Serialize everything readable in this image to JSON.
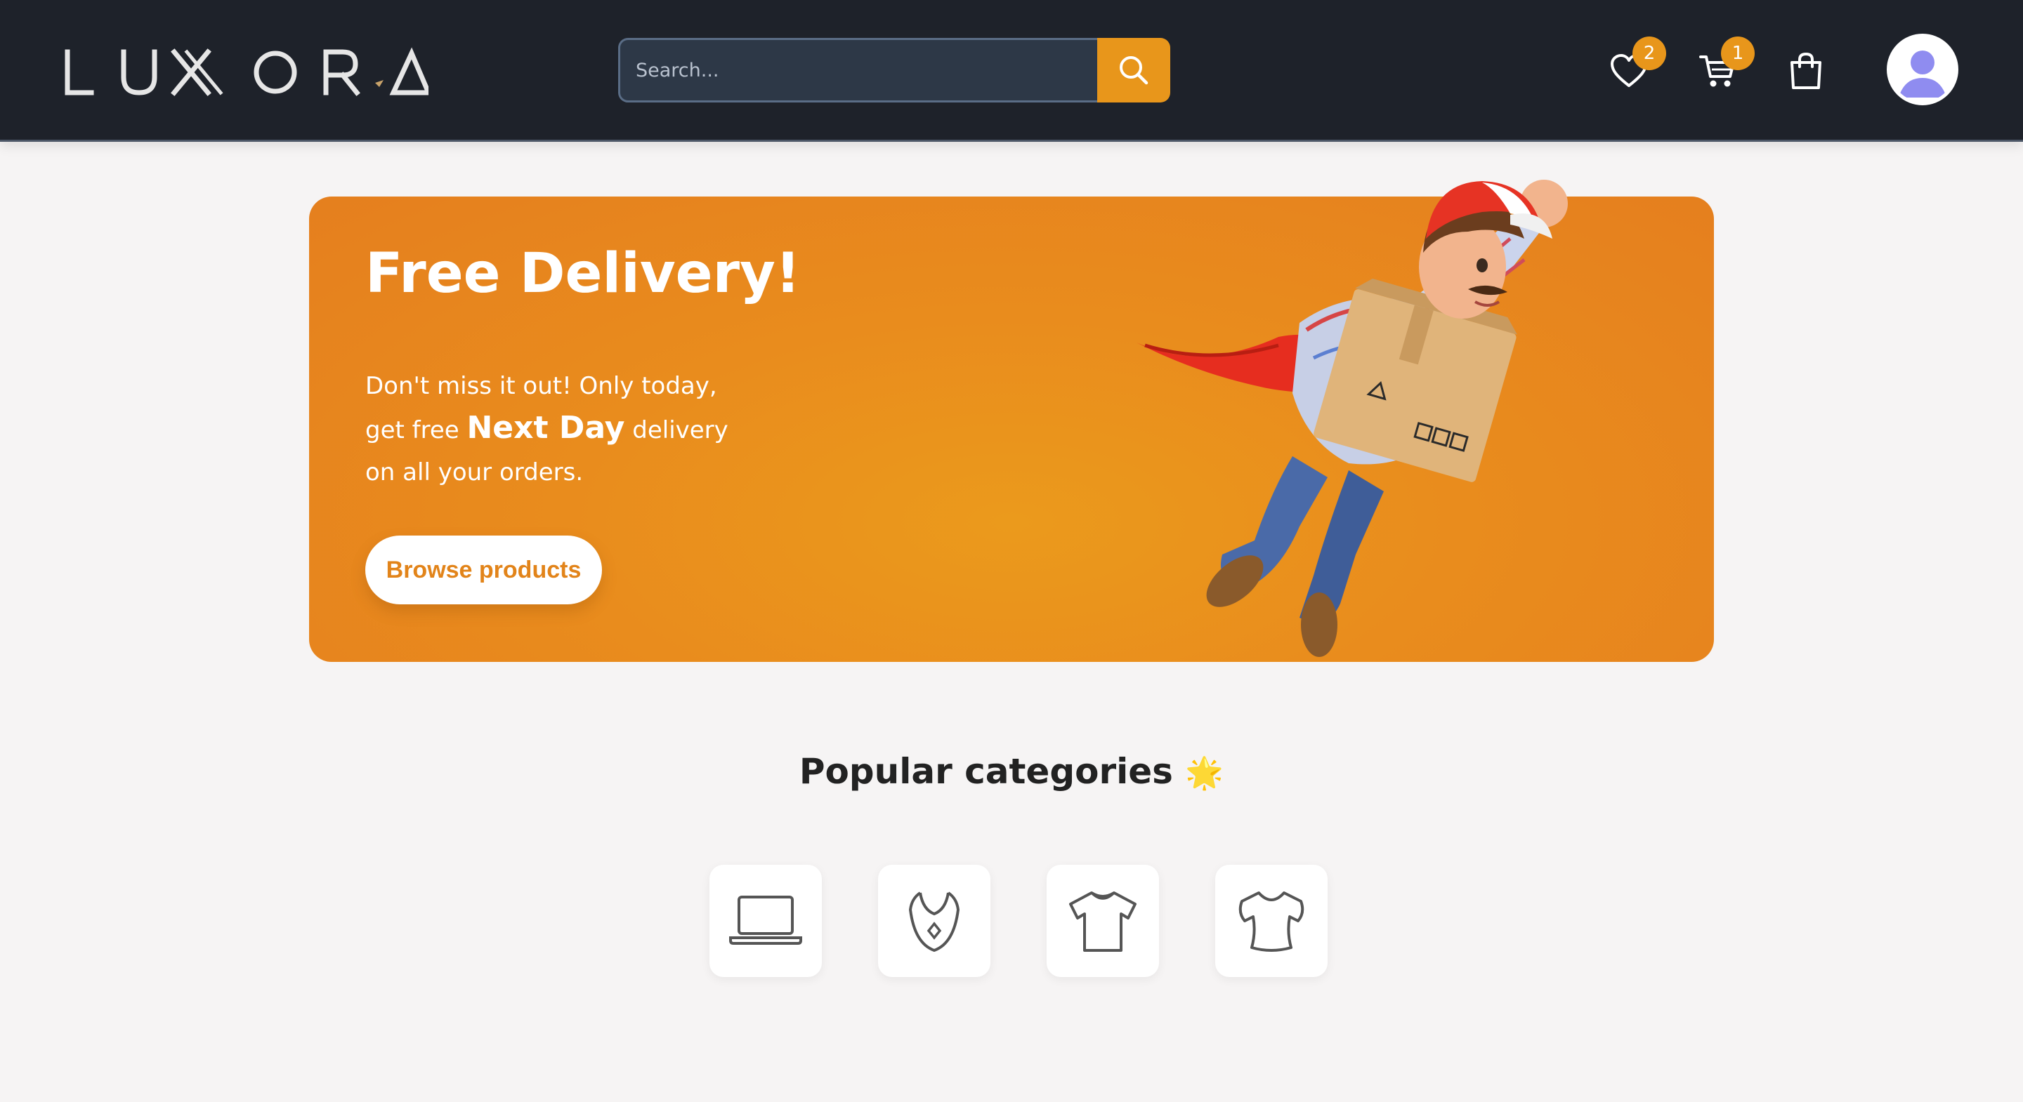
{
  "header": {
    "logo_text": "LUXORA",
    "search": {
      "placeholder": "Search...",
      "value": ""
    },
    "wishlist": {
      "icon": "heart-icon",
      "count": "2"
    },
    "cart": {
      "icon": "cart-icon",
      "count": "1"
    },
    "bag": {
      "icon": "shopping-bag-icon"
    },
    "account": {
      "icon": "user-avatar-icon"
    }
  },
  "hero": {
    "title": "Free Delivery!",
    "line1": "Don't miss it out! Only today,",
    "line2_prefix": "get free ",
    "line2_strong": "Next Day",
    "line2_suffix": " delivery",
    "line3": "on all your orders.",
    "button_label": "Browse products",
    "image": "flying-delivery-man-illustration"
  },
  "categories": {
    "title": "Popular categories",
    "title_emoji": "🌟",
    "items": [
      {
        "icon": "laptop-icon"
      },
      {
        "icon": "necklace-icon"
      },
      {
        "icon": "tshirt-icon"
      },
      {
        "icon": "blouse-icon"
      }
    ]
  },
  "colors": {
    "header_bg": "#1e222a",
    "accent": "#e8961b",
    "hero_bg": "#e98c1d",
    "page_bg": "#f6f4f4"
  }
}
